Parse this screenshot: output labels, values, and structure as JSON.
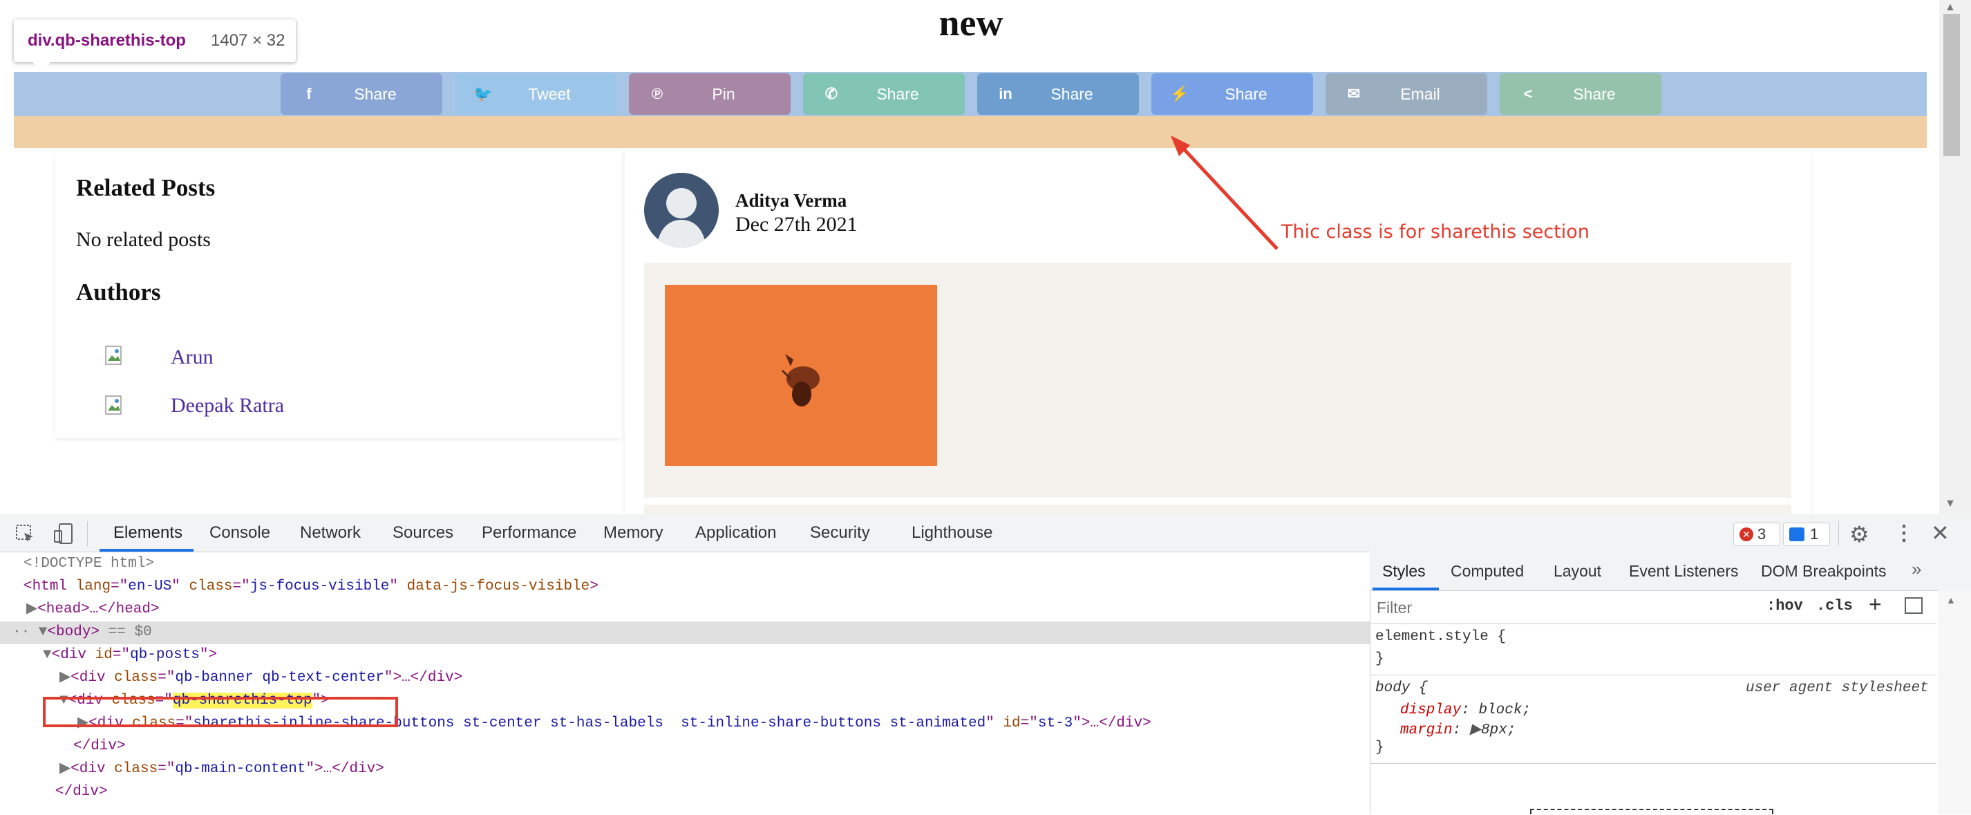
{
  "page": {
    "title": "new",
    "tooltip": {
      "selector": "div.qb-sharethis-top",
      "size": "1407 × 32"
    },
    "share_buttons": [
      {
        "label": "Share",
        "icon": "facebook-icon",
        "glyph": "f",
        "color": "#8aa6d6"
      },
      {
        "label": "Tweet",
        "icon": "twitter-icon",
        "glyph": "🐦",
        "color": "#9cc5ea"
      },
      {
        "label": "Pin",
        "icon": "pinterest-icon",
        "glyph": "℗",
        "color": "#a886a6"
      },
      {
        "label": "Share",
        "icon": "whatsapp-icon",
        "glyph": "✆",
        "color": "#82c5b4"
      },
      {
        "label": "Share",
        "icon": "linkedin-icon",
        "glyph": "in",
        "color": "#6e9ed0"
      },
      {
        "label": "Share",
        "icon": "messenger-icon",
        "glyph": "⚡",
        "color": "#79a2e6"
      },
      {
        "label": "Email",
        "icon": "email-icon",
        "glyph": "✉",
        "color": "#9aaebf"
      },
      {
        "label": "Share",
        "icon": "sharethis-icon",
        "glyph": "<",
        "color": "#94c2aa"
      }
    ],
    "sidebar": {
      "related_heading": "Related Posts",
      "related_text": "No related posts",
      "authors_heading": "Authors",
      "authors": [
        "Arun",
        "Deepak Ratra"
      ]
    },
    "post": {
      "author": "Aditya Verma",
      "date": "Dec 27th 2021"
    },
    "annotation": "Thic class is for sharethis section"
  },
  "devtools": {
    "tabs": [
      "Elements",
      "Console",
      "Network",
      "Sources",
      "Performance",
      "Memory",
      "Application",
      "Security",
      "Lighthouse"
    ],
    "active_tab": "Elements",
    "error_count": "3",
    "message_count": "1",
    "dom": {
      "doctype": "<!DOCTYPE html>",
      "html_tag": "html",
      "html_lang": "en-US",
      "html_class": "js-focus-visible",
      "html_attr3": "data-js-focus-visible",
      "head": "head",
      "body": "body",
      "body_marker": "== $0",
      "posts_id": "qb-posts",
      "banner_class": "qb-banner qb-text-center",
      "sharethis_class": "qb-sharethis-top",
      "inline_class": "sharethis-inline-share-buttons st-center st-has-labels  st-inline-share-buttons st-animated",
      "inline_id": "st-3",
      "main_class": "qb-main-content"
    },
    "styles_tabs": [
      "Styles",
      "Computed",
      "Layout",
      "Event Listeners",
      "DOM Breakpoints"
    ],
    "filter_placeholder": "Filter",
    "hov": ":hov",
    "cls": ".cls",
    "rules": {
      "element_style": "element.style {",
      "close": "}",
      "body_selector": "body {",
      "ua_label": "user agent stylesheet",
      "display_prop": "display",
      "display_val": "block;",
      "margin_prop": "margin",
      "margin_val": "8px;"
    }
  }
}
